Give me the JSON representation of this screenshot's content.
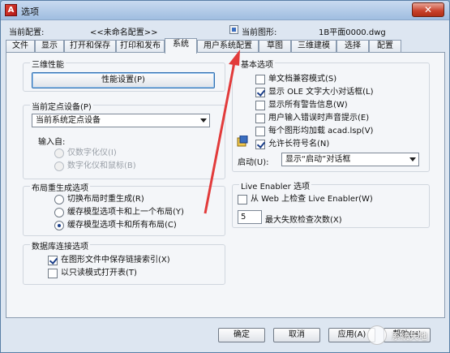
{
  "window": {
    "title": "选项",
    "close_glyph": "✕"
  },
  "header": {
    "current_profile_label": "当前配置:",
    "current_profile_value": "<<未命名配置>>",
    "current_drawing_label": "当前图形:",
    "current_drawing_value": "1B平面0000.dwg"
  },
  "tabs": [
    "文件",
    "显示",
    "打开和保存",
    "打印和发布",
    "系统",
    "用户系统配置",
    "草图",
    "三维建模",
    "选择",
    "配置"
  ],
  "active_tab": "系统",
  "three_d": {
    "title": "三维性能",
    "button": "性能设置(P)"
  },
  "pointing": {
    "title": "当前定点设备(P)",
    "select_value": "当前系统定点设备",
    "input_from_label": "输入自:",
    "options": [
      "仅数字化仪(I)",
      "数字化仪和鼠标(B)"
    ]
  },
  "layout_regen": {
    "title": "布局重生成选项",
    "options": [
      "切换布局时重生成(R)",
      "缓存模型选项卡和上一个布局(Y)",
      "缓存模型选项卡和所有布局(C)"
    ],
    "selected_index": 2
  },
  "db_conn": {
    "title": "数据库连接选项",
    "options": [
      {
        "label": "在图形文件中保存链接索引(X)",
        "checked": true
      },
      {
        "label": "以只读模式打开表(T)",
        "checked": false
      }
    ]
  },
  "basic": {
    "title": "基本选项",
    "options": [
      {
        "label": "单文档兼容模式(S)",
        "checked": false
      },
      {
        "label": "显示 OLE 文字大小对话框(L)",
        "checked": true
      },
      {
        "label": "显示所有警告信息(W)",
        "checked": false
      },
      {
        "label": "用户输入错误时声音提示(E)",
        "checked": false
      },
      {
        "label": "每个图形均加载 acad.lsp(V)",
        "checked": false
      },
      {
        "label": "允许长符号名(N)",
        "checked": true
      }
    ],
    "startup_label": "启动(U):",
    "startup_value": "显示“启动”对话框"
  },
  "live_enabler": {
    "title": "Live Enabler 选项",
    "check_label": "从 Web 上检查 Live Enabler(W)",
    "checked": false,
    "max_fail_value": "5",
    "max_fail_label": "最大失败检查次数(X)"
  },
  "footer": {
    "ok": "确定",
    "cancel": "取消",
    "apply": "应用(A)",
    "help": "帮助(H)"
  },
  "watermark": {
    "text": "系统天地"
  },
  "colors": {
    "arrow": "#e23b3b",
    "accent": "#2f6fb0"
  }
}
